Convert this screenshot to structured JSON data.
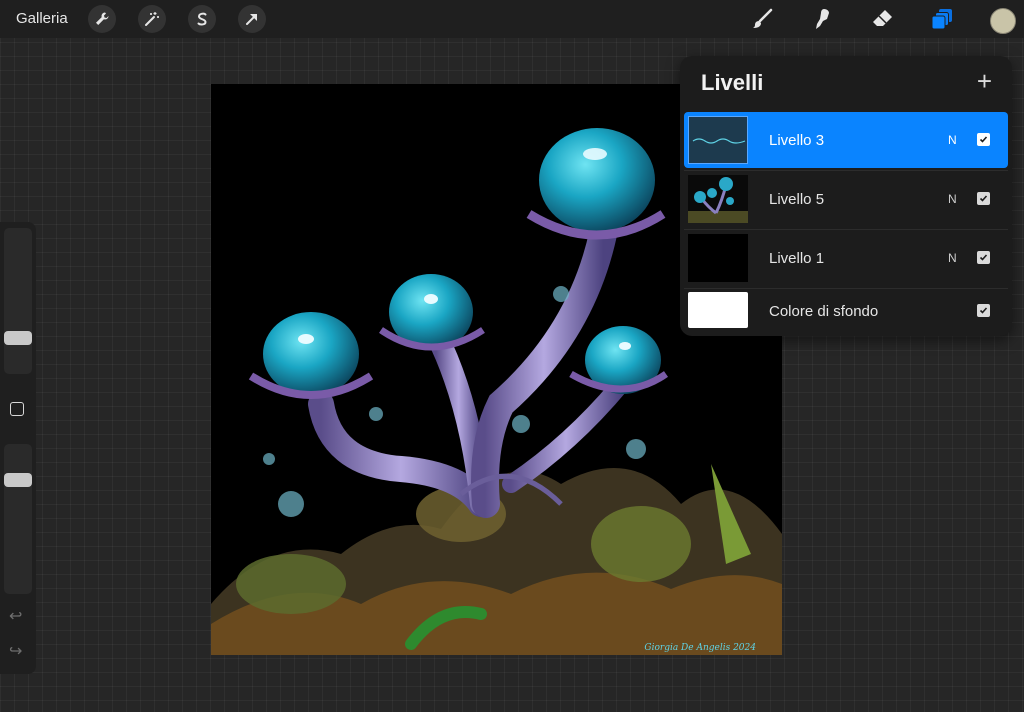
{
  "topbar": {
    "gallery_label": "Galleria",
    "tools_left": [
      "wrench-icon",
      "magic-wand-icon",
      "selection-s-icon",
      "transform-arrow-icon"
    ],
    "tools_right": [
      "brush-icon",
      "smudge-icon",
      "eraser-icon",
      "layers-icon"
    ],
    "active_tool": "layers-icon",
    "accent_color": "#0a84ff",
    "current_color": "#c9c4a8"
  },
  "sidebar": {
    "buttons": [
      "modify-square-icon",
      "undo-icon",
      "redo-icon"
    ]
  },
  "canvas": {
    "signature": "Giorgia De Angelis 2024"
  },
  "layers": {
    "title": "Livelli",
    "add_symbol": "+",
    "items": [
      {
        "name": "Livello 3",
        "blend": "N",
        "visible": true,
        "active": true
      },
      {
        "name": "Livello 5",
        "blend": "N",
        "visible": true,
        "active": false
      },
      {
        "name": "Livello 1",
        "blend": "N",
        "visible": true,
        "active": false
      },
      {
        "name": "Colore di sfondo",
        "blend": "",
        "visible": true,
        "active": false
      }
    ]
  }
}
